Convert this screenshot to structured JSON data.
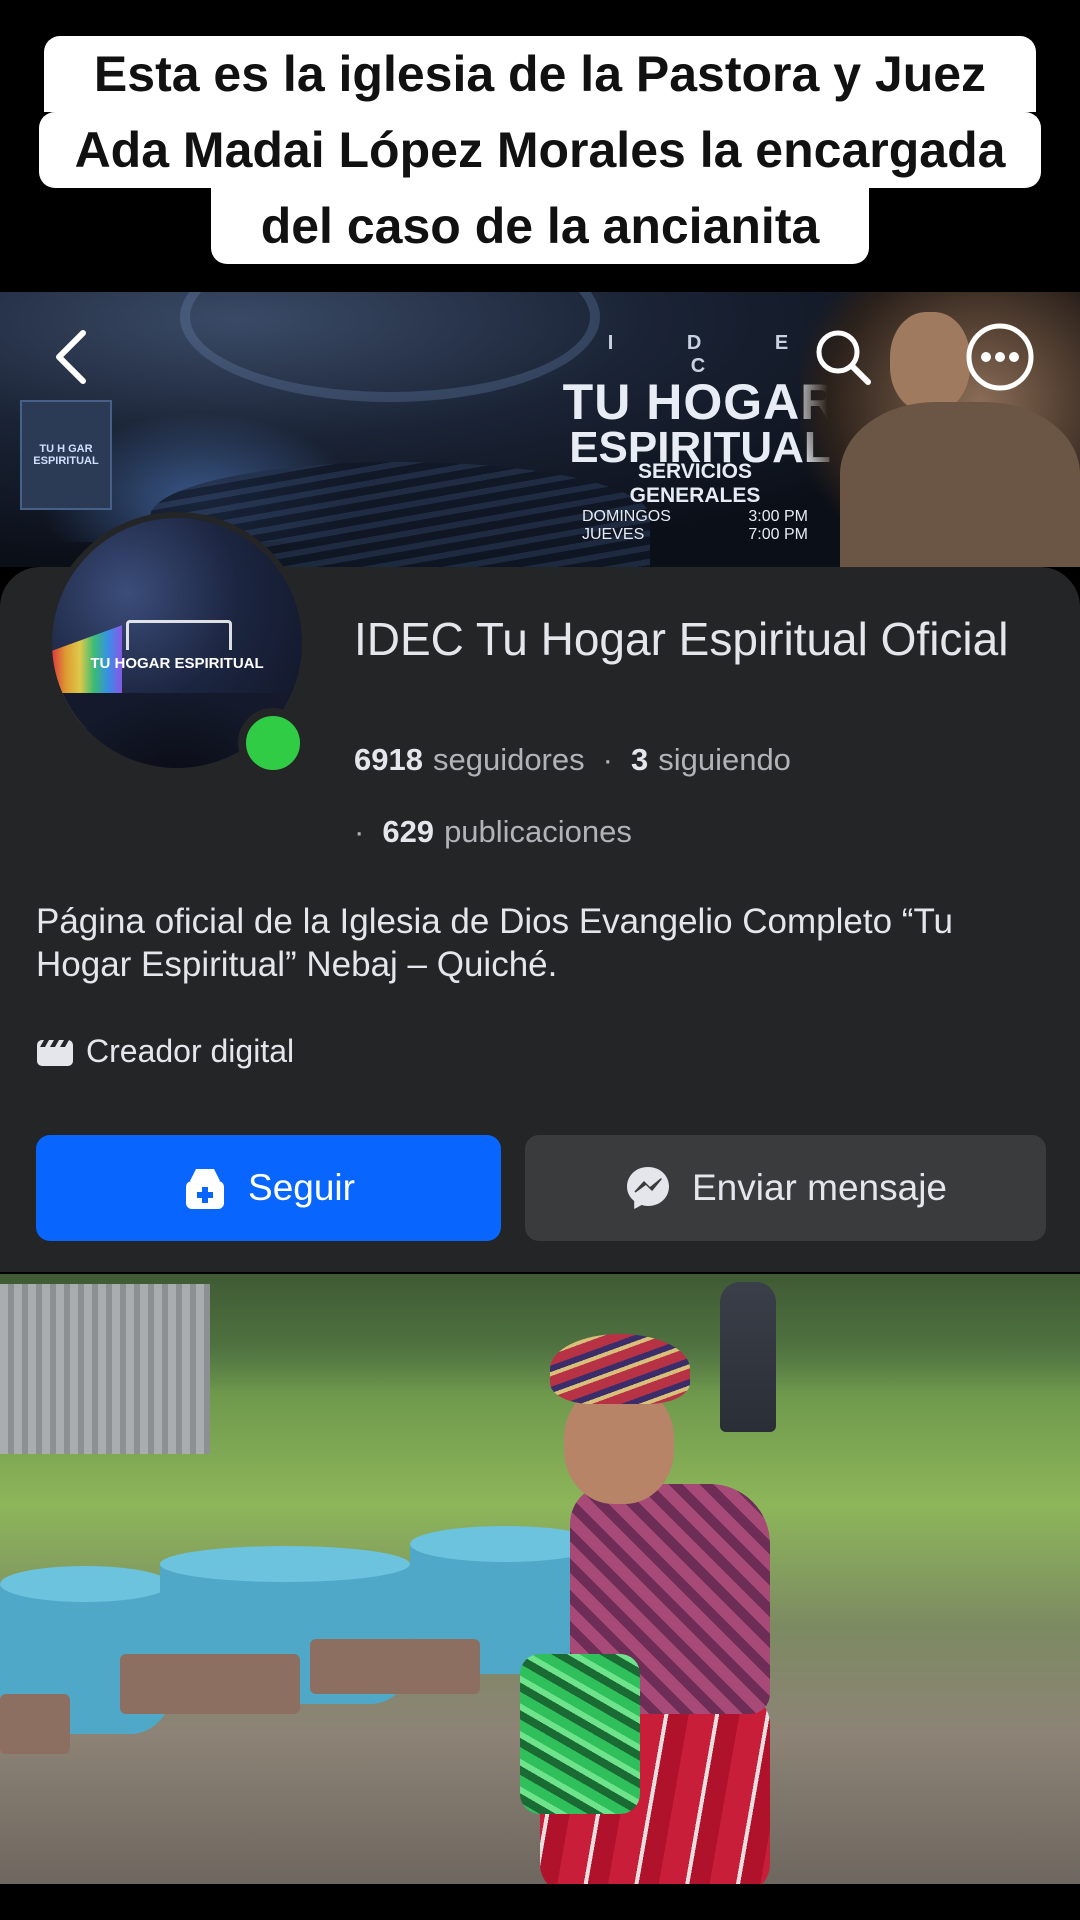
{
  "caption": {
    "line1": "Esta es la iglesia de la Pastora y Juez",
    "line2": "Ada Madai López Morales la encargada",
    "line3": "del caso de la ancianita"
  },
  "cover": {
    "brand_top": "I D E C",
    "brand_line1": "TU HOGAR",
    "brand_line2": "ESPIRITUAL",
    "services_title": "SERVICIOS GENERALES",
    "services": [
      {
        "day": "DOMINGOS",
        "time": "3:00 PM"
      },
      {
        "day": "JUEVES",
        "time": "7:00 PM"
      }
    ],
    "screen_text": "TU H GAR ESPIRITUAL"
  },
  "nav": {
    "back_icon": "chevron-left-icon",
    "search_icon": "search-icon",
    "more_icon": "more-options-icon"
  },
  "profile": {
    "avatar_text": "TU HOGAR ESPIRITUAL",
    "name": "IDEC Tu Hogar Espiritual Oficial",
    "followers_count": "6918",
    "followers_label": "seguidores",
    "following_count": "3",
    "following_label": "siguiendo",
    "posts_count": "629",
    "posts_label": "publicaciones",
    "separator": "·",
    "bio": "Página oficial de la Iglesia de Dios Evangelio Completo “Tu Hogar Espiritual” Nebaj – Quiché.",
    "category": "Creador digital",
    "online_color": "#31cc46"
  },
  "actions": {
    "follow_label": "Seguir",
    "message_label": "Enviar mensaje",
    "follow_color": "#0866ff"
  }
}
